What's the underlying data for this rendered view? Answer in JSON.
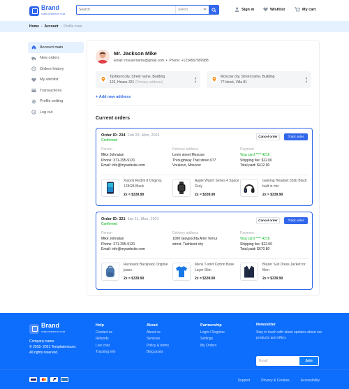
{
  "brand": {
    "name": "Brand",
    "tagline": "TEMPLATEMOUNT.COM"
  },
  "search": {
    "placeholder": "Search",
    "select_value": "Select"
  },
  "header_nav": [
    {
      "label": "Sign in",
      "icon": "user-icon"
    },
    {
      "label": "Wishlist",
      "icon": "heart-icon"
    },
    {
      "label": "My cart",
      "icon": "cart-icon"
    }
  ],
  "breadcrumb": [
    {
      "label": "Home",
      "active": true
    },
    {
      "label": "Account",
      "active": true
    },
    {
      "label": "Profile main",
      "active": false
    }
  ],
  "sidebar": {
    "items": [
      {
        "label": "Account main",
        "icon": "home-icon",
        "active": true
      },
      {
        "label": "New orders",
        "icon": "truck-icon"
      },
      {
        "label": "Orders history",
        "icon": "history-icon"
      },
      {
        "label": "My wishlist",
        "icon": "heart-icon"
      },
      {
        "label": "Transactions",
        "icon": "card-icon"
      },
      {
        "label": "Profile setting",
        "icon": "gear-icon"
      },
      {
        "label": "Log out",
        "icon": "logout-icon"
      }
    ]
  },
  "profile": {
    "name": "Mr. Jackson Mike",
    "email_label": "Email:",
    "email": "myusername@gmail.com",
    "phone_label": "Phone:",
    "phone": "+1234567890988",
    "addresses": [
      {
        "line1": "Tashkent city, Street name, Building",
        "line2": "123, House 321",
        "note": "(Primary address)"
      },
      {
        "line1": "Moscow city, Street name, Building",
        "line2": "77-block, Villa 81",
        "note": ""
      }
    ],
    "add_address": "Add new address"
  },
  "orders_title": "Current orders",
  "orders": [
    {
      "id_label": "Order ID: 234",
      "date": "Feb 23, Mon, 2021",
      "status": "Confirmed",
      "cancel": "Cancel order",
      "track": "Track order",
      "person_title": "Person",
      "person": [
        "Mike Johnatan",
        "Phone: 371-295-9131",
        "Email: info@mywebsite.com"
      ],
      "delivery_title": "Delivery address",
      "delivery": [
        "Lenin street Moscow",
        "Throughway That street 077",
        "Vnukovo, Moscow"
      ],
      "payment_title": "Payment",
      "payment_visa": "Visa card **** 4216",
      "payment": [
        "Shipping fee: $12.00",
        "Total paid: $412.00"
      ],
      "items": [
        {
          "name": "Xiaomi Redmi 8 Original, 128GB Black",
          "price": "2x = $339.90",
          "icon": "phone-icon"
        },
        {
          "name": "Apple Watch Series 4 Space Gray",
          "price": "2x = $339.90",
          "icon": "watch-icon"
        },
        {
          "name": "Gaming Headset 32db Black built in mic",
          "price": "2x = $339.90",
          "icon": "headset-icon"
        }
      ]
    },
    {
      "id_label": "Order ID: 321",
      "date": "Jan 11, Mon, 2021",
      "status": "Confirmed",
      "cancel": "Cancel order",
      "track": "Track order",
      "person_title": "Person",
      "person": [
        "Mike Johnatan",
        "Phone: 371-295-9131",
        "Email: info@mywebsite.com"
      ],
      "delivery_title": "Delivery address",
      "delivery": [
        "1000 Glavpochta Amir Temur",
        "street, Tashkent city",
        ""
      ],
      "payment_title": "Payment",
      "payment_visa": "Visa card **** 4216",
      "payment": [
        "Shipping fee: $12.00",
        "Total paid: $670.80"
      ],
      "items": [
        {
          "name": "Rucksack Backpack Original jeans",
          "price": "2x = $339.90",
          "icon": "backpack-icon"
        },
        {
          "name": "Mens T-shirt Cotton Base Layer Slim",
          "price": "2x = $339.90",
          "icon": "tshirt-icon"
        },
        {
          "name": "Blazer Suit Dress Jacket for Men",
          "price": "2x = $339.90",
          "icon": "blazer-icon"
        }
      ]
    }
  ],
  "footer": {
    "company": [
      "Company name.",
      "© 2018- 2021 Templatemount.",
      "All rights reserved."
    ],
    "columns": [
      {
        "title": "Help",
        "links": [
          "Contact us",
          "Refunds",
          "Live chat",
          "Tracking info"
        ]
      },
      {
        "title": "About",
        "links": [
          "About us",
          "Services",
          "Policy & terms",
          "Blog posts"
        ]
      },
      {
        "title": "Partnership",
        "links": [
          "Login / Register",
          "Settings",
          "My Orders"
        ]
      }
    ],
    "newsletter": {
      "title": "Newsletter",
      "desc": "Stay in touch with latest updates about our products and offers",
      "placeholder": "Email",
      "button": "Join"
    },
    "bottom_links": [
      "Support",
      "Privacy & Cookies",
      "Accessibility"
    ],
    "payment_cards": [
      "visa-icon",
      "mastercard-icon",
      "paypal-icon",
      "amex-icon"
    ]
  },
  "colors": {
    "primary": "#3167eb",
    "accent_green": "#00b517",
    "footer_bg": "#0d6efd",
    "crumb_bg": "#e5f1ff"
  }
}
